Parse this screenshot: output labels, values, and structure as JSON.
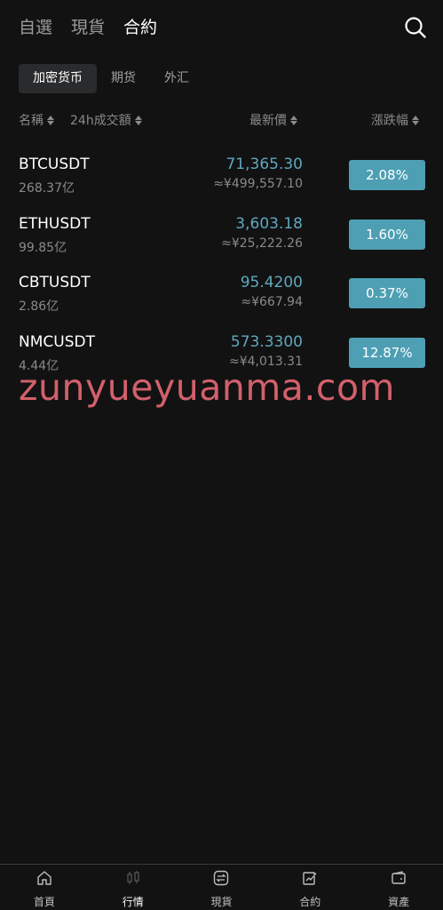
{
  "top_tabs": [
    {
      "label": "自選",
      "active": false
    },
    {
      "label": "現貨",
      "active": false
    },
    {
      "label": "合約",
      "active": true
    }
  ],
  "search": {
    "icon": "search-icon"
  },
  "sub_tabs": [
    {
      "label": "加密货币",
      "active": true
    },
    {
      "label": "期货",
      "active": false
    },
    {
      "label": "外汇",
      "active": false
    }
  ],
  "columns": {
    "name": "名稱",
    "volume": "24h成交額",
    "price": "最新價",
    "change": "漲跌幅"
  },
  "rows": [
    {
      "symbol": "BTCUSDT",
      "volume": "268.37亿",
      "price": "71,365.30",
      "cny": "≈¥499,557.10",
      "change": "2.08%"
    },
    {
      "symbol": "ETHUSDT",
      "volume": "99.85亿",
      "price": "3,603.18",
      "cny": "≈¥25,222.26",
      "change": "1.60%"
    },
    {
      "symbol": "CBTUSDT",
      "volume": "2.86亿",
      "price": "95.4200",
      "cny": "≈¥667.94",
      "change": "0.37%"
    },
    {
      "symbol": "NMCUSDT",
      "volume": "4.44亿",
      "price": "573.3300",
      "cny": "≈¥4,013.31",
      "change": "12.87%"
    }
  ],
  "watermark": "zunyueyuanma.com",
  "bottom_nav": [
    {
      "label": "首頁",
      "icon": "home-icon",
      "active": false
    },
    {
      "label": "行情",
      "icon": "candlestick-icon",
      "active": true
    },
    {
      "label": "現貨",
      "icon": "swap-icon",
      "active": false
    },
    {
      "label": "合約",
      "icon": "contract-icon",
      "active": false
    },
    {
      "label": "資產",
      "icon": "wallet-icon",
      "active": false
    }
  ],
  "colors": {
    "background": "#121212",
    "up_green": "#4e9fb3",
    "price_blue": "#5fa8bf",
    "watermark": "#d2606b"
  }
}
